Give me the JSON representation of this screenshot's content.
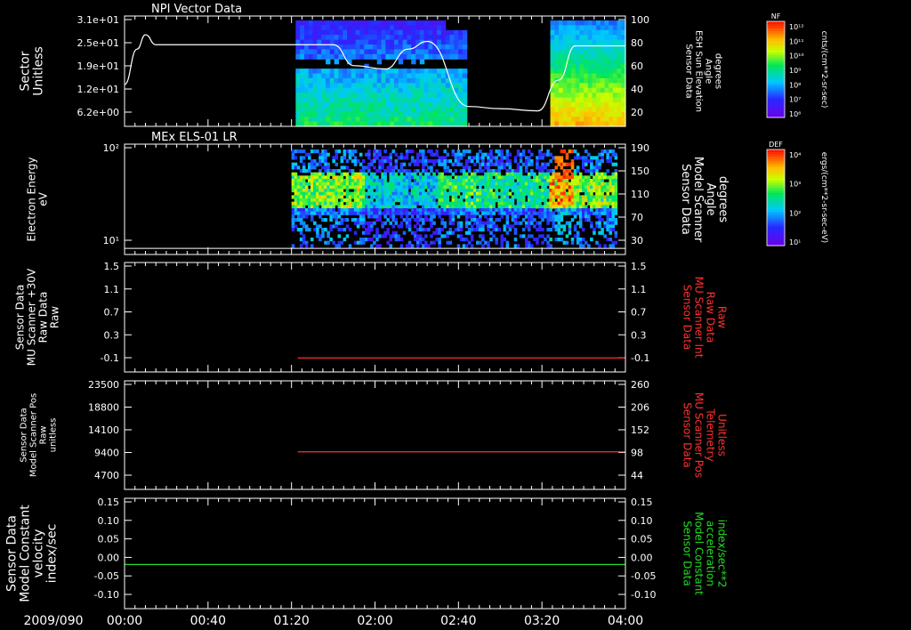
{
  "panels": [
    {
      "id": "npi",
      "title": "NPI Vector Data",
      "left_label": [
        "Sector",
        "Unitless"
      ],
      "left_ticks": [
        "3.1e+01",
        "2.5e+01",
        "1.9e+01",
        "1.2e+01",
        "6.2e+00"
      ],
      "right_label": [
        "Sensor Data",
        "ESH Sun Elevation",
        "Angle",
        "degrees"
      ],
      "right_ticks": [
        "100",
        "80",
        "60",
        "40",
        "20"
      ],
      "colorbar": {
        "tag": "NF",
        "ticks": [
          "10¹²",
          "10¹¹",
          "10¹⁰",
          "10⁹",
          "10⁸",
          "10⁷",
          "10⁶"
        ],
        "units": "cnts/(cm**2-sr-sec)"
      }
    },
    {
      "id": "els",
      "title": "MEx ELS-01 LR",
      "left_label": [
        "Electron Energy",
        "eV"
      ],
      "left_ticks": [
        "10²",
        "10¹"
      ],
      "right_label": [
        "Sensor Data",
        "Model Scanner",
        "Angle",
        "degrees"
      ],
      "right_ticks": [
        "190",
        "150",
        "110",
        "70",
        "30"
      ],
      "colorbar": {
        "tag": "DEF",
        "ticks": [
          "10⁴",
          "10³",
          "10²",
          "10¹"
        ],
        "units": "ergs/(cm**2-sr-sec-eV)"
      }
    },
    {
      "id": "mu_int",
      "left_label": [
        "Sensor Data",
        "MU Scanner +30V",
        "Raw Data",
        "Raw"
      ],
      "left_ticks": [
        "1.5",
        "1.1",
        "0.7",
        "0.3",
        "-0.1"
      ],
      "right_label": [
        "Sensor Data",
        "MU Scanner Int",
        "Raw Data",
        "Raw"
      ],
      "right_ticks": [
        "1.5",
        "1.1",
        "0.7",
        "0.3",
        "-0.1"
      ]
    },
    {
      "id": "mu_pos",
      "left_label": [
        "Sensor Data",
        "Model Scanner Pos",
        "Raw",
        "unitless"
      ],
      "left_ticks": [
        "23500",
        "18800",
        "14100",
        "9400",
        "4700"
      ],
      "right_label": [
        "Sensor Data",
        "MU Scanner Pos",
        "Telemetry",
        "Unitless"
      ],
      "right_ticks": [
        "260",
        "206",
        "152",
        "98",
        "44"
      ]
    },
    {
      "id": "model_const",
      "left_label": [
        "Sensor Data",
        "Model Constant",
        "velocity",
        "index/sec"
      ],
      "left_ticks": [
        "0.15",
        "0.10",
        "0.05",
        "0.00",
        "-0.05",
        "-0.10"
      ],
      "right_label": [
        "Sensor Data",
        "Model Constant",
        "acceleration",
        "index/sec**2"
      ],
      "right_ticks": [
        "0.15",
        "0.10",
        "0.05",
        "0.00",
        "-0.05",
        "-0.10"
      ]
    }
  ],
  "x_axis": {
    "date_label": "2009/090",
    "ticks": [
      "00:00",
      "00:40",
      "01:20",
      "02:00",
      "02:40",
      "03:20",
      "04:00"
    ]
  },
  "colors": {
    "background": "#000000",
    "axis": "#ffffff",
    "sun_elevation": "#ffffff",
    "mu_scanner_int": "#ff3030",
    "mu_scanner_pos": "#ff3030",
    "model_acceleration": "#22dd22"
  },
  "chart_data": [
    {
      "type": "heatmap",
      "title": "NPI Vector Data",
      "x_range": [
        "00:00",
        "04:00"
      ],
      "ylabel": "Sector Unitless",
      "data_intervals": [
        [
          "01:22",
          "02:44"
        ],
        [
          "03:24",
          "04:00"
        ]
      ],
      "series": [
        {
          "name": "Sensor Data ESH Sun Elevation Angle",
          "type": "line",
          "axis": "right",
          "ylim": [
            0,
            100
          ],
          "x": [
            "00:00",
            "00:06",
            "00:10",
            "00:15",
            "01:00",
            "01:40",
            "01:50",
            "02:05",
            "02:16",
            "02:25",
            "02:45",
            "03:00",
            "03:18",
            "03:28",
            "03:36",
            "04:00"
          ],
          "y": [
            38,
            70,
            83,
            74,
            74,
            74,
            55,
            52,
            70,
            77,
            18,
            16,
            14,
            42,
            73,
            73
          ]
        }
      ]
    },
    {
      "type": "heatmap",
      "title": "MEx ELS-01 LR",
      "x_range": [
        "00:00",
        "04:00"
      ],
      "ylabel": "Electron Energy eV",
      "yscale": "log",
      "data_intervals": [
        [
          "01:20",
          "03:56"
        ]
      ],
      "series": [
        {
          "name": "Sensor Data Model Scanner Angle",
          "type": "line",
          "axis": "right",
          "ylim": [
            10,
            190
          ],
          "x": [
            "00:00",
            "04:00"
          ],
          "y": [
            20,
            20
          ]
        }
      ]
    },
    {
      "type": "line",
      "x_range": [
        "00:00",
        "04:00"
      ],
      "ylim": [
        -0.3,
        1.5
      ],
      "series": [
        {
          "name": "Sensor Data MU Scanner Int Raw Data",
          "axis": "right",
          "x": [
            "01:23",
            "04:00"
          ],
          "y": [
            -0.07,
            -0.07
          ]
        }
      ]
    },
    {
      "type": "line",
      "x_range": [
        "00:00",
        "04:00"
      ],
      "ylim": [
        0,
        23500
      ],
      "right_ylim": [
        0,
        260
      ],
      "series": [
        {
          "name": "Sensor Data MU Scanner Pos Telemetry",
          "axis": "right",
          "x": [
            "01:23",
            "04:00"
          ],
          "y": [
            90,
            90
          ]
        }
      ]
    },
    {
      "type": "line",
      "x_range": [
        "00:00",
        "04:00"
      ],
      "ylim": [
        -0.1,
        0.15
      ],
      "series": [
        {
          "name": "Sensor Data Model Constant acceleration",
          "axis": "right",
          "x": [
            "00:00",
            "04:00"
          ],
          "y": [
            0.0,
            0.0
          ]
        }
      ]
    }
  ]
}
